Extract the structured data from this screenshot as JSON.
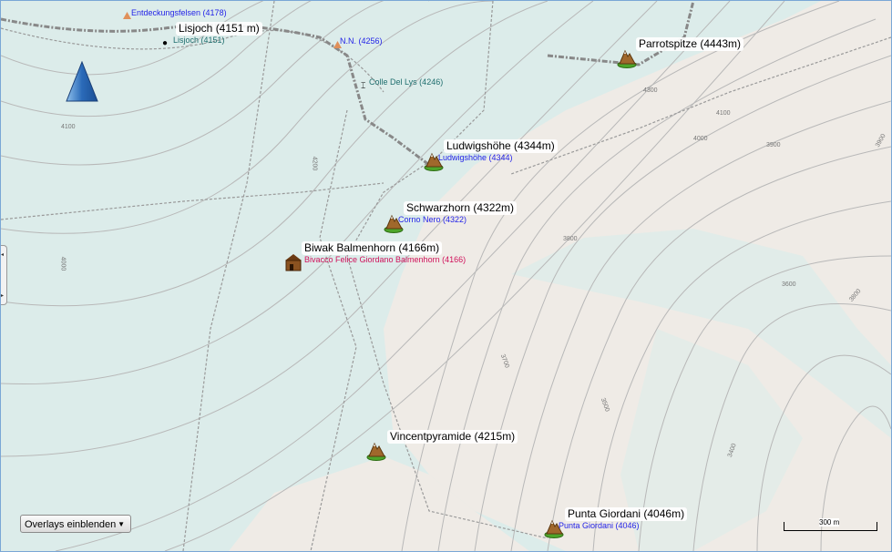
{
  "peaks": [
    {
      "name": "Parrotspitze (4443m)"
    },
    {
      "name": "Ludwigshöhe (4344m)",
      "sub": "Ludwigshöhe (4344)"
    },
    {
      "name": "Schwarzhorn (4322m)",
      "sub": "Corno Nero (4322)"
    },
    {
      "name": "Biwak Balmenhorn (4166m)",
      "sub": "Bivacco Felice Giordano Balmenhorn (4166)"
    },
    {
      "name": "Vincentpyramide (4215m)"
    },
    {
      "name": "Punta Giordani (4046m)",
      "sub": "Punta Giordani (4046)"
    }
  ],
  "pass": {
    "name": "Lisjoch (4151 m)",
    "sub": "Lisjoch (4151)"
  },
  "points": {
    "entdeckungsfelsen": "Entdeckungsfelsen (4178)",
    "nn": "N.N. (4256)",
    "colle": "Colle Del Lys (4246)"
  },
  "contours": [
    "4100",
    "4200",
    "4300",
    "4100",
    "4000",
    "3900",
    "3800",
    "3700",
    "3600",
    "3500",
    "3400",
    "4000",
    "3800",
    "3900"
  ],
  "controls": {
    "overlays": "Overlays einblenden",
    "scale": "300 m"
  },
  "colors": {
    "glacier": "#dcecea",
    "rock": "#efebe6",
    "contour": "#b5b5b5"
  }
}
